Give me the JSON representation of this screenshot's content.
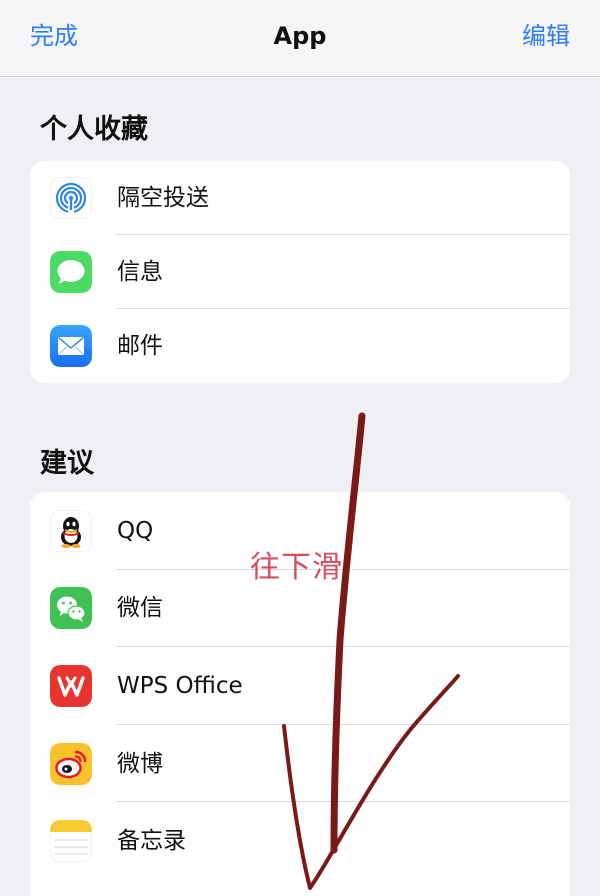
{
  "nav": {
    "done_label": "完成",
    "title": "App",
    "edit_label": "编辑"
  },
  "favorites": {
    "title": "个人收藏",
    "items": [
      {
        "label": "隔空投送",
        "icon": "airdrop-icon"
      },
      {
        "label": "信息",
        "icon": "messages-icon"
      },
      {
        "label": "邮件",
        "icon": "mail-icon"
      }
    ]
  },
  "suggestions": {
    "title": "建议",
    "items": [
      {
        "label": "QQ",
        "icon": "qq-icon"
      },
      {
        "label": "微信",
        "icon": "wechat-icon"
      },
      {
        "label": "WPS Office",
        "icon": "wps-office-icon"
      },
      {
        "label": "微博",
        "icon": "weibo-icon"
      },
      {
        "label": "备忘录",
        "icon": "notes-icon"
      }
    ]
  },
  "annotation": {
    "text": "往下滑"
  },
  "colors": {
    "accent": "#2f7cf6",
    "annotation": "#d84c5f",
    "scribble": "#7a1a16"
  }
}
